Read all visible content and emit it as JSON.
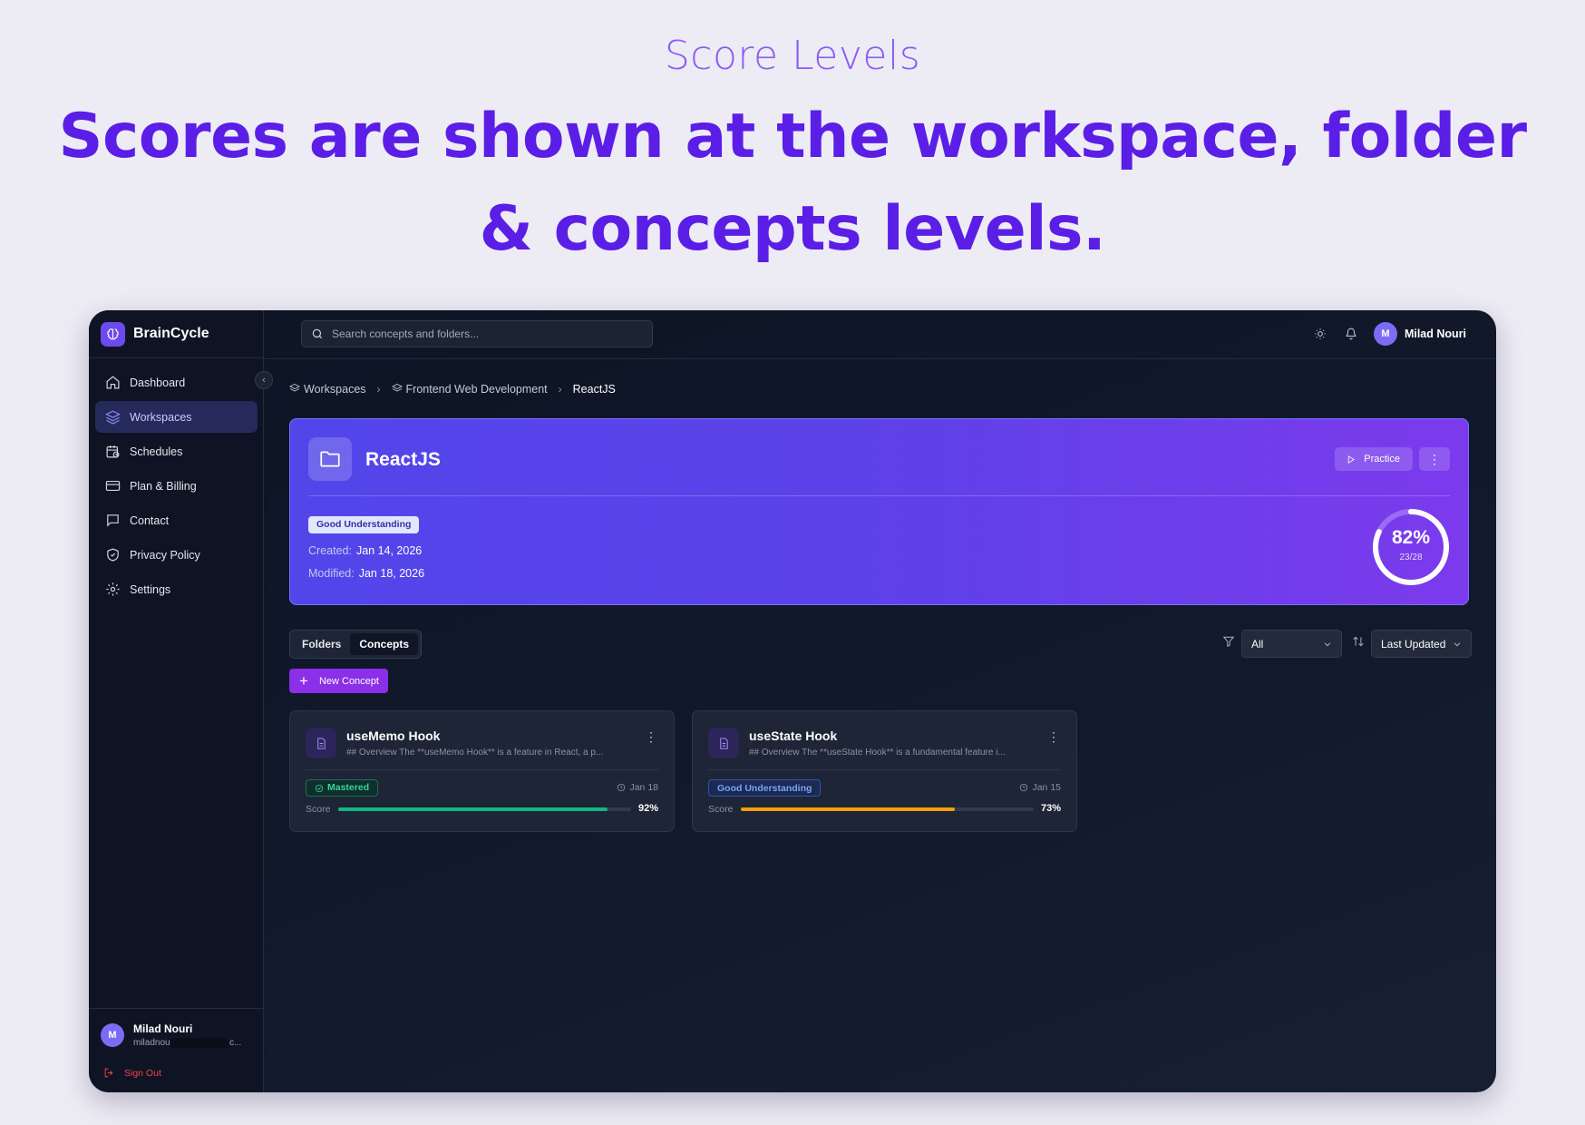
{
  "promo": {
    "kicker": "Score Levels",
    "headline": "Scores are shown at the workspace, folder & concepts levels."
  },
  "brand": {
    "name": "BrainCycle",
    "logo_icon": "brain-icon",
    "accent": "#6d4af0"
  },
  "sidebar": {
    "items": [
      {
        "label": "Dashboard",
        "icon": "home-icon"
      },
      {
        "label": "Workspaces",
        "icon": "layers-icon",
        "active": true
      },
      {
        "label": "Schedules",
        "icon": "calendar-clock-icon"
      },
      {
        "label": "Plan & Billing",
        "icon": "credit-card-icon"
      },
      {
        "label": "Contact",
        "icon": "message-icon"
      },
      {
        "label": "Privacy Policy",
        "icon": "shield-icon"
      },
      {
        "label": "Settings",
        "icon": "gear-icon"
      }
    ],
    "user": {
      "initial": "M",
      "name": "Milad Nouri",
      "email_start": "miladnou",
      "email_end": "c..."
    },
    "sign_out": "Sign Out"
  },
  "topbar": {
    "search_placeholder": "Search concepts and folders...",
    "user": {
      "initial": "M",
      "name": "Milad Nouri"
    }
  },
  "breadcrumb": {
    "items": [
      "Workspaces",
      "Frontend Web Development",
      "ReactJS"
    ]
  },
  "folder": {
    "title": "ReactJS",
    "practice_label": "Practice",
    "more_label": "⋮",
    "badge": "Good Understanding",
    "created_label": "Created:",
    "created": "Jan 14, 2026",
    "modified_label": "Modified:",
    "modified": "Jan 18, 2026",
    "score_text": "82%",
    "score_fraction": 0.82,
    "score_count": "23/28"
  },
  "tabs": [
    {
      "label": "Folders",
      "active": false
    },
    {
      "label": "Concepts",
      "active": true
    }
  ],
  "filters": {
    "filter_value": "All",
    "sort_value": "Last Updated"
  },
  "new_concept_label": "New Concept",
  "concepts": [
    {
      "title": "useMemo Hook",
      "description": "## Overview The **useMemo Hook** is a feature in React, a p...",
      "badge": "Mastered",
      "date": "Jan 18",
      "score_label": "Score",
      "score_text": "92%",
      "score_fraction": 0.92,
      "bar_color": "#10b981"
    },
    {
      "title": "useState Hook",
      "description": "## Overview The **useState Hook** is a fundamental feature i...",
      "badge": "Good Understanding",
      "date": "Jan 15",
      "score_label": "Score",
      "score_text": "73%",
      "score_fraction": 0.73,
      "bar_color": "#f59e0b"
    }
  ]
}
